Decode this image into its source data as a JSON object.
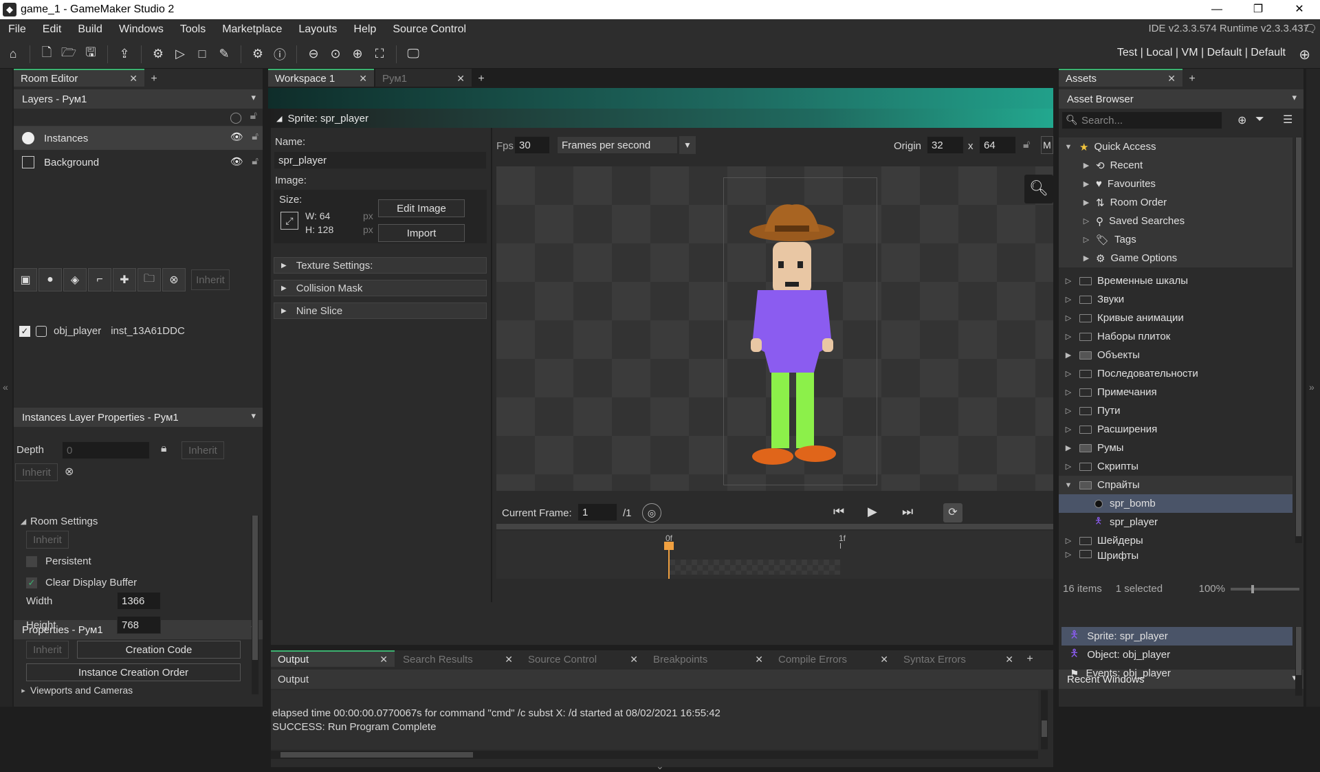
{
  "window": {
    "title": "game_1 - GameMaker Studio 2",
    "minimize": "—",
    "restore": "❐",
    "close": "✕"
  },
  "menu": {
    "items": [
      "File",
      "Edit",
      "Build",
      "Windows",
      "Tools",
      "Marketplace",
      "Layouts",
      "Help",
      "Source Control"
    ],
    "version": "IDE v2.3.3.574  Runtime v2.3.3.437"
  },
  "toolbar": {
    "target": "Test | Local | VM | Default | Default"
  },
  "room_editor": {
    "tab": "Room Editor",
    "layers_header": "Layers - Рум1",
    "layers": [
      {
        "name": "Instances",
        "icon": "instances-icon"
      },
      {
        "name": "Background",
        "icon": "background-icon"
      }
    ],
    "inherit_btn": "Inherit",
    "inst_props_header": "Instances Layer Properties - Рум1",
    "instance": {
      "object": "obj_player",
      "id": "inst_13A61DDC"
    },
    "depth_label": "Depth",
    "depth_value": "0",
    "props_header": "Properties - Рум1",
    "room_settings": "Room Settings",
    "persistent": "Persistent",
    "clear_display": "Clear Display Buffer",
    "width_label": "Width",
    "width_value": "1366",
    "height_label": "Height",
    "height_value": "768",
    "creation_code": "Creation Code",
    "instance_order": "Instance Creation Order",
    "viewports": "Viewports and Cameras"
  },
  "workspace": {
    "tabs": [
      {
        "label": "Workspace 1",
        "active": true
      },
      {
        "label": "Рум1",
        "active": false
      }
    ],
    "sprite_title": "Sprite: spr_player",
    "name_label": "Name:",
    "name_value": "spr_player",
    "image_label": "Image:",
    "size_label": "Size:",
    "w": "W: 64",
    "h": "H: 128",
    "px": "px",
    "edit_image": "Edit Image",
    "import": "Import",
    "sections": [
      "Texture Settings:",
      "Collision Mask",
      "Nine Slice"
    ],
    "fps_label": "Fps",
    "fps_value": "30",
    "fps_mode": "Frames per second",
    "origin_label": "Origin",
    "origin_x": "32",
    "origin_sep": "x",
    "origin_y": "64",
    "origin_btn": "M",
    "current_frame_label": "Current Frame:",
    "current_frame": "1",
    "frame_total": "/1",
    "timeline_marks": [
      "0f",
      "1f"
    ]
  },
  "output": {
    "tabs": [
      "Output",
      "Search Results",
      "Source Control",
      "Breakpoints",
      "Compile Errors",
      "Syntax Errors"
    ],
    "header": "Output",
    "lines": [
      "elapsed time 00:00:00.0770067s for command \"cmd\" /c subst X: /d started at 08/02/2021 16:55:42",
      "SUCCESS: Run Program Complete"
    ]
  },
  "assets": {
    "tab": "Assets",
    "browser_header": "Asset Browser",
    "search_placeholder": "Search...",
    "quick_access": "Quick Access",
    "quick_items": [
      "Recent",
      "Favourites",
      "Room Order",
      "Saved Searches",
      "Tags",
      "Game Options"
    ],
    "folders": [
      "Временные шкалы",
      "Звуки",
      "Кривые анимации",
      "Наборы плиток",
      "Объекты",
      "Последовательности",
      "Примечания",
      "Пути",
      "Расширения",
      "Румы",
      "Скрипты",
      "Спрайты"
    ],
    "sprites": [
      "spr_bomb",
      "spr_player"
    ],
    "folders_after": [
      "Шейдеры",
      "Шрифты"
    ],
    "status_items": "16 items",
    "status_selected": "1 selected",
    "zoom": "100%",
    "recent_header": "Recent Windows",
    "recent": [
      "Sprite: spr_player",
      "Object: obj_player",
      "Events: obj_player"
    ]
  }
}
